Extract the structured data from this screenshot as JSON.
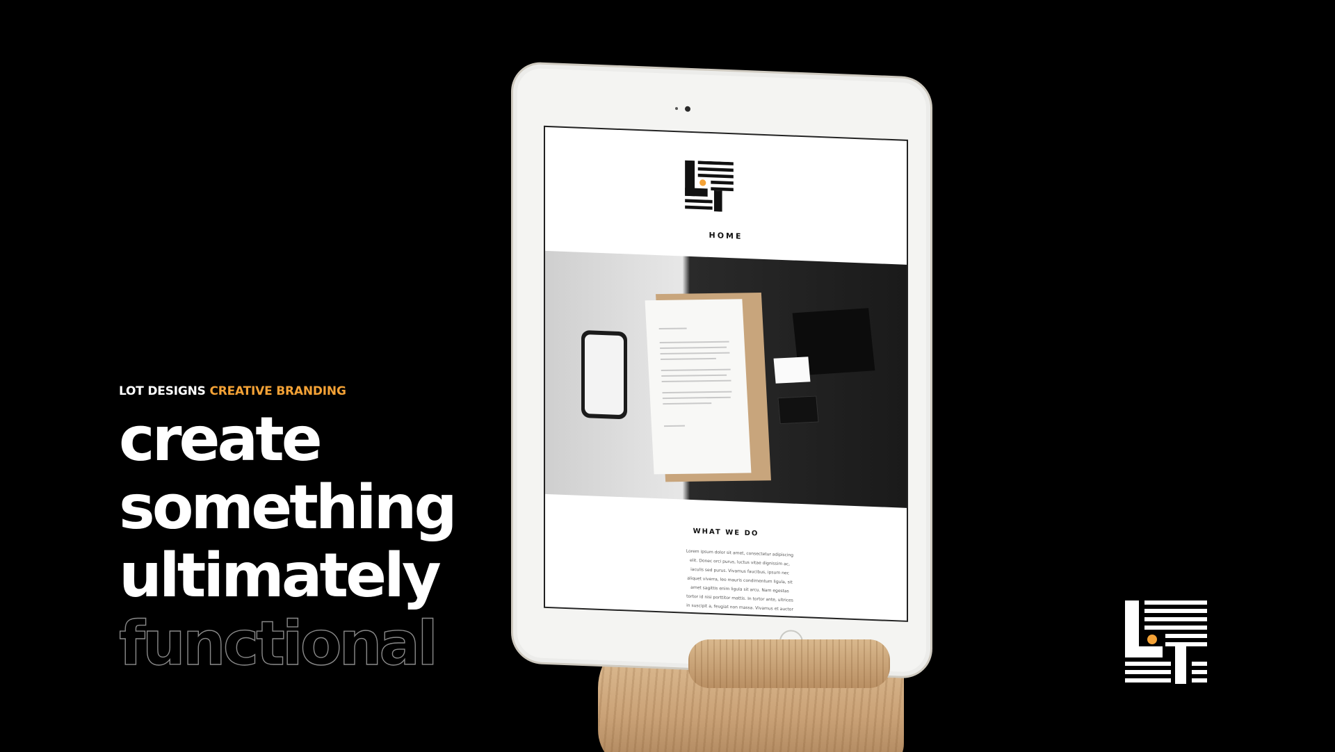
{
  "brand": {
    "eyebrow_name": "LOT DESIGNS",
    "eyebrow_tagline": "CREATIVE BRANDING",
    "accent_color": "#f4a236"
  },
  "headline": {
    "line1": "create",
    "line2": "something",
    "line3": "ultimately",
    "line4": "functional"
  },
  "tablet_screen": {
    "nav_title": "HOME",
    "section_title": "WHAT WE DO",
    "body_text": "Lorem ipsum dolor sit amet, consectetur adipiscing elit. Donec orci purus, luctus vitae dignissim ac, iaculis sed purus. Vivamus faucibus, ipsum nec aliquet viverra, leo mauris condimentum ligula, sit amet sagittis enim ligula sit arcu. Nam egestas tortor id nisi porttitor mattis. In tortor ante, ultrices in suscipit a, feugiat non massa. Vivamus et auctor mi. Fusce vel massa nulla."
  },
  "logos": {
    "corner_logo": "lot-logo-icon",
    "screen_logo": "lot-logo-icon"
  }
}
